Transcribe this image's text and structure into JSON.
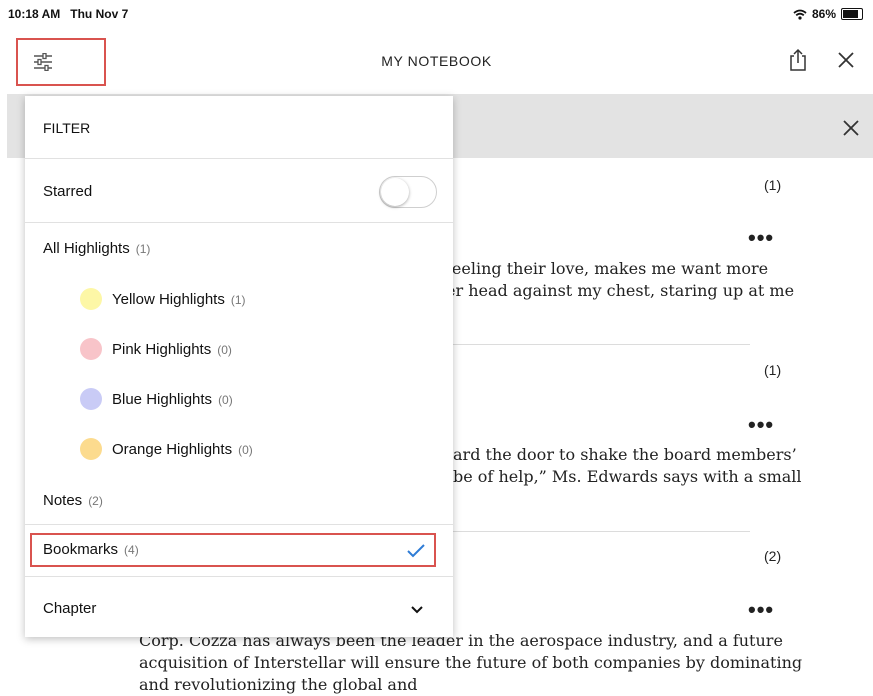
{
  "status_bar": {
    "time": "10:18 AM",
    "date": "Thu Nov 7",
    "battery": "86%"
  },
  "header": {
    "title": "MY NOTEBOOK"
  },
  "icons": {
    "filter": "sliders-icon",
    "share": "share-icon",
    "close": "close-icon",
    "wifi": "wifi-icon"
  },
  "colors": {
    "yellow": "#fdf7a6",
    "pink": "#f8c4c9",
    "blue": "#c9cbf6",
    "orange": "#fcdb8e",
    "accent_red": "#d9534f",
    "check_blue": "#2e7cd6"
  },
  "filter": {
    "heading": "FILTER",
    "starred_label": "Starred",
    "all_highlights": {
      "label": "All Highlights",
      "count": "(1)"
    },
    "highlights": [
      {
        "label": "Yellow Highlights",
        "count": "(1)"
      },
      {
        "label": "Pink Highlights",
        "count": "(0)"
      },
      {
        "label": "Blue Highlights",
        "count": "(0)"
      },
      {
        "label": "Orange Highlights",
        "count": "(0)"
      }
    ],
    "notes": {
      "label": "Notes",
      "count": "(2)"
    },
    "bookmarks": {
      "label": "Bookmarks",
      "count": "(4)"
    },
    "chapter": {
      "label": "Chapter"
    }
  },
  "notebook": {
    "entries": [
      {
        "count": "(1)",
        "text_lines": [
          "feeling their love, makes me want more",
          "er head against my chest, staring up at me"
        ]
      },
      {
        "count": "(1)",
        "text_lines": [
          "ard the door to shake the board members’",
          "be of help,” Ms. Edwards says with a small"
        ]
      },
      {
        "count": "(2)",
        "text_lines": [
          "Corp. Cozza has always been the leader in the aerospace industry, and a future",
          "acquisition of Interstellar will ensure the future of both companies by dominating",
          "and revolutionizing the global and"
        ]
      }
    ]
  }
}
